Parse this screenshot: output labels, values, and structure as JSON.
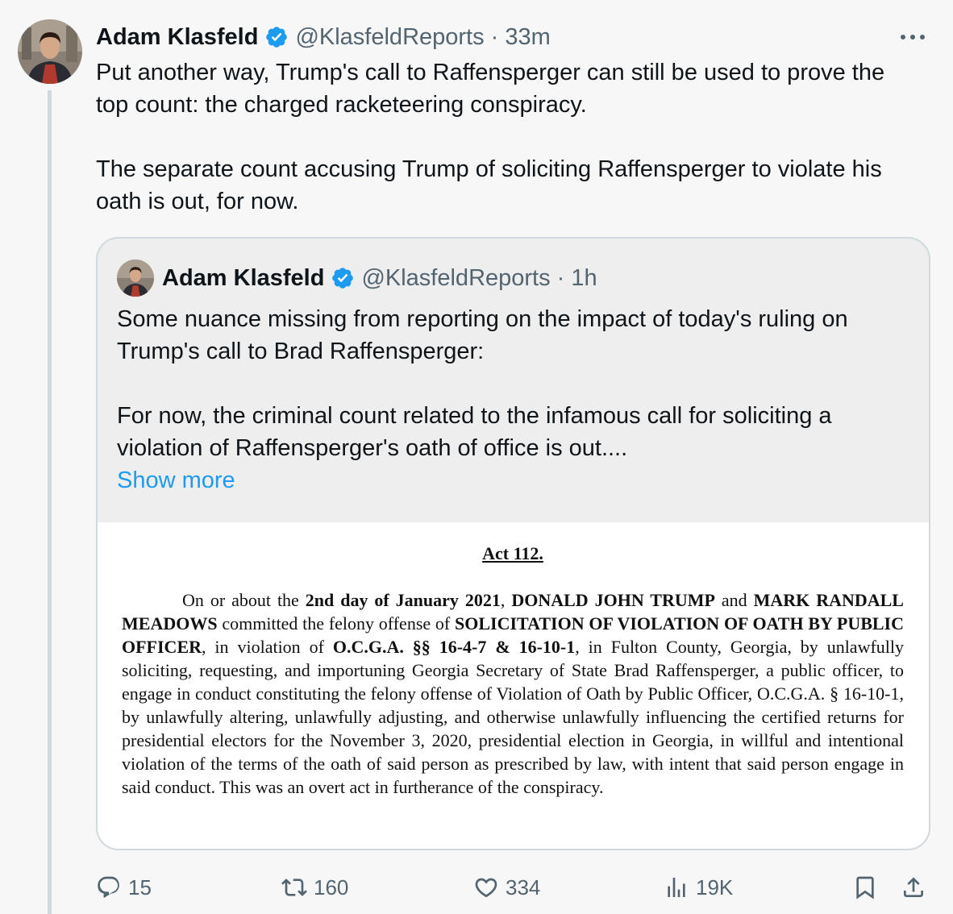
{
  "tweet": {
    "author_name": "Adam Klasfeld",
    "handle_time": "@KlasfeldReports · 33m",
    "paragraphs": [
      "Put another way, Trump's call to Raffensperger can still be used to prove the top count: the charged racketeering conspiracy.",
      "The separate count accusing Trump of soliciting Raffensperger to violate his oath is out, for now."
    ]
  },
  "quote": {
    "author_name": "Adam Klasfeld",
    "handle_time": "@KlasfeldReports · 1h",
    "paragraphs": [
      "Some nuance missing from reporting on the impact of today's ruling on Trump's call to Brad Raffensperger:",
      "For now, the criminal count related to the infamous call for soliciting a violation of Raffensperger's oath of office is out...."
    ],
    "show_more": "Show more",
    "document": {
      "title": "Act 112.",
      "body_parts": [
        {
          "t": "On or about the ",
          "b": false
        },
        {
          "t": "2nd day of January 2021",
          "b": true
        },
        {
          "t": ", ",
          "b": false
        },
        {
          "t": "DONALD JOHN TRUMP",
          "b": true
        },
        {
          "t": " and ",
          "b": false
        },
        {
          "t": "MARK RANDALL MEADOWS",
          "b": true
        },
        {
          "t": " committed the felony offense of ",
          "b": false
        },
        {
          "t": "SOLICITATION OF VIOLATION OF OATH BY PUBLIC OFFICER",
          "b": true
        },
        {
          "t": ", in violation of ",
          "b": false
        },
        {
          "t": "O.C.G.A. §§ 16-4-7 & 16-10-1",
          "b": true
        },
        {
          "t": ", in Fulton County, Georgia, by unlawfully soliciting, requesting, and importuning Georgia Secretary of State Brad Raffensperger, a public officer, to engage in conduct constituting the felony offense of Violation of Oath by Public Officer, O.C.G.A. § 16-10-1, by unlawfully altering, unlawfully adjusting, and otherwise unlawfully influencing the certified returns for presidential electors for the November 3, 2020, presidential election in Georgia, in willful and intentional violation of the terms of the oath of said person as prescribed by law, with intent that said person engage in said conduct. This was an overt act in furtherance of the conspiracy.",
          "b": false
        }
      ]
    }
  },
  "actions": {
    "replies": "15",
    "reposts": "160",
    "likes": "334",
    "views": "19K"
  },
  "colors": {
    "text": "#0f1419",
    "muted": "#536471",
    "link": "#1d9bf0",
    "verified": "#1d9bf0",
    "background": "#f7f7f7",
    "quote_background": "#eeeeee",
    "border": "#cfd9de"
  },
  "icons": {
    "verified": "verified-badge-icon",
    "more": "more-options-icon",
    "reply": "reply-icon",
    "repost": "repost-icon",
    "like": "heart-icon",
    "views": "views-icon",
    "bookmark": "bookmark-icon",
    "share": "share-icon"
  }
}
